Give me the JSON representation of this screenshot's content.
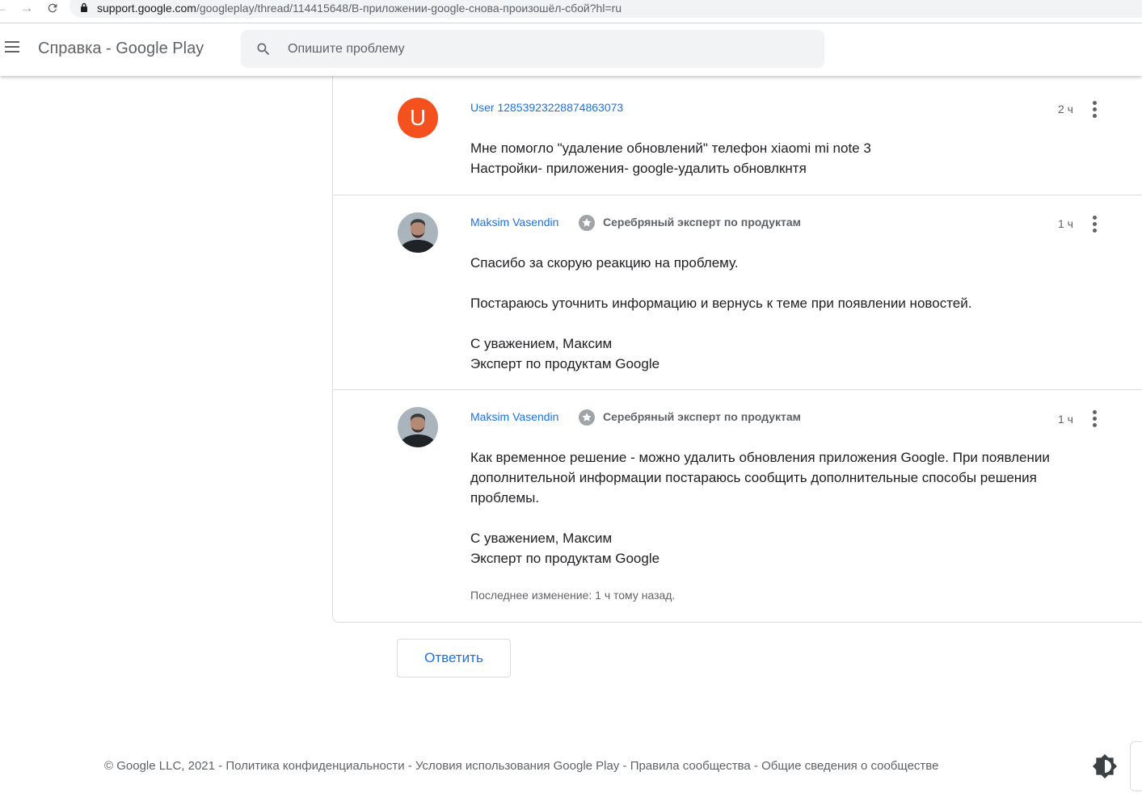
{
  "browser": {
    "url_host": "support.google.com",
    "url_path": "/googleplay/thread/114415648/В-приложении-google-снова-произошёл-сбой?hl=ru"
  },
  "header": {
    "title": "Справка - Google Play",
    "search_placeholder": "Опишите проблему"
  },
  "replies": [
    {
      "author": "User 12853923228874863073",
      "avatar_letter": "U",
      "time": "2 ч",
      "lines": [
        "Мне помогло \"удаление обновлений\" телефон xiaomi mi note 3",
        "Настройки- приложения- google-удалить обновлкнтя"
      ]
    },
    {
      "author": "Maksim Vasendin",
      "badge": "Серебряный эксперт по продуктам",
      "time": "1 ч",
      "lines": [
        "Спасибо за скорую реакцию на проблему.",
        "Постараюсь уточнить информацию и вернусь к теме при появлении новостей.",
        "С уважением, Максим",
        "Эксперт по продуктам Google"
      ]
    },
    {
      "author": "Maksim Vasendin",
      "badge": "Серебряный эксперт по продуктам",
      "time": "1 ч",
      "lines": [
        "Как временное решение - можно удалить обновления приложения Google. При появлении",
        "дополнительной информации постараюсь сообщить дополнительные способы решения",
        "проблемы.",
        "С уважением, Максим",
        "Эксперт по продуктам Google"
      ],
      "edited": "Последнее изменение: 1 ч тому назад."
    }
  ],
  "reply_button": "Ответить",
  "footer": {
    "copyright": "© Google LLC, 2021",
    "sep": " - ",
    "links": [
      "Политика конфиденциальности",
      "Условия использования Google Play",
      "Правила сообщества",
      "Общие сведения о сообществе"
    ]
  },
  "icons": {
    "badge": "silver-star-badge-icon",
    "theme": "brightness-icon",
    "more": "more-vert-icon"
  },
  "colors": {
    "link": "#1a73e8",
    "avatar_u": "#f4511e",
    "muted": "#5f6368"
  }
}
